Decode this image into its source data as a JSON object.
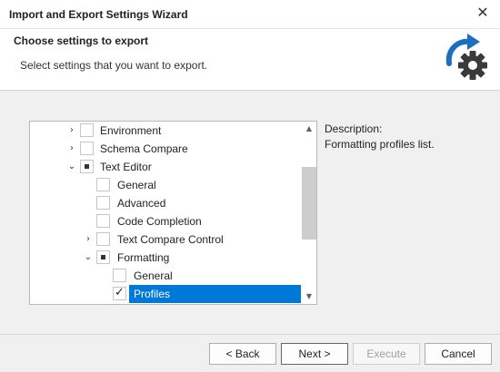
{
  "window": {
    "title": "Import and Export Settings Wizard",
    "close_glyph": "✕"
  },
  "header": {
    "title": "Choose settings to export",
    "subtitle": "Select settings that you want to export.",
    "logo_icon": "export-settings-gear-icon",
    "accent_color": "#1b6fc1"
  },
  "tree": {
    "items": [
      {
        "label": "Environment",
        "expander": "›",
        "check": "unchecked"
      },
      {
        "label": "Schema Compare",
        "expander": "›",
        "check": "unchecked"
      },
      {
        "label": "Text Editor",
        "expander": "⌄",
        "check": "partial"
      },
      {
        "label": "General",
        "expander": "",
        "check": "unchecked"
      },
      {
        "label": "Advanced",
        "expander": "",
        "check": "unchecked"
      },
      {
        "label": "Code Completion",
        "expander": "",
        "check": "unchecked"
      },
      {
        "label": "Text Compare Control",
        "expander": "›",
        "check": "unchecked"
      },
      {
        "label": "Formatting",
        "expander": "⌄",
        "check": "partial"
      },
      {
        "label": "General",
        "expander": "",
        "check": "unchecked"
      },
      {
        "label": "Profiles",
        "expander": "",
        "check": "checked",
        "selected": true
      }
    ],
    "scroll_up": "▲",
    "scroll_down": "▼",
    "selection_color": "#0078d7"
  },
  "description": {
    "label": "Description:",
    "text": "Formatting profiles list."
  },
  "footer": {
    "back": "< Back",
    "next": "Next >",
    "execute": "Execute",
    "cancel": "Cancel"
  }
}
